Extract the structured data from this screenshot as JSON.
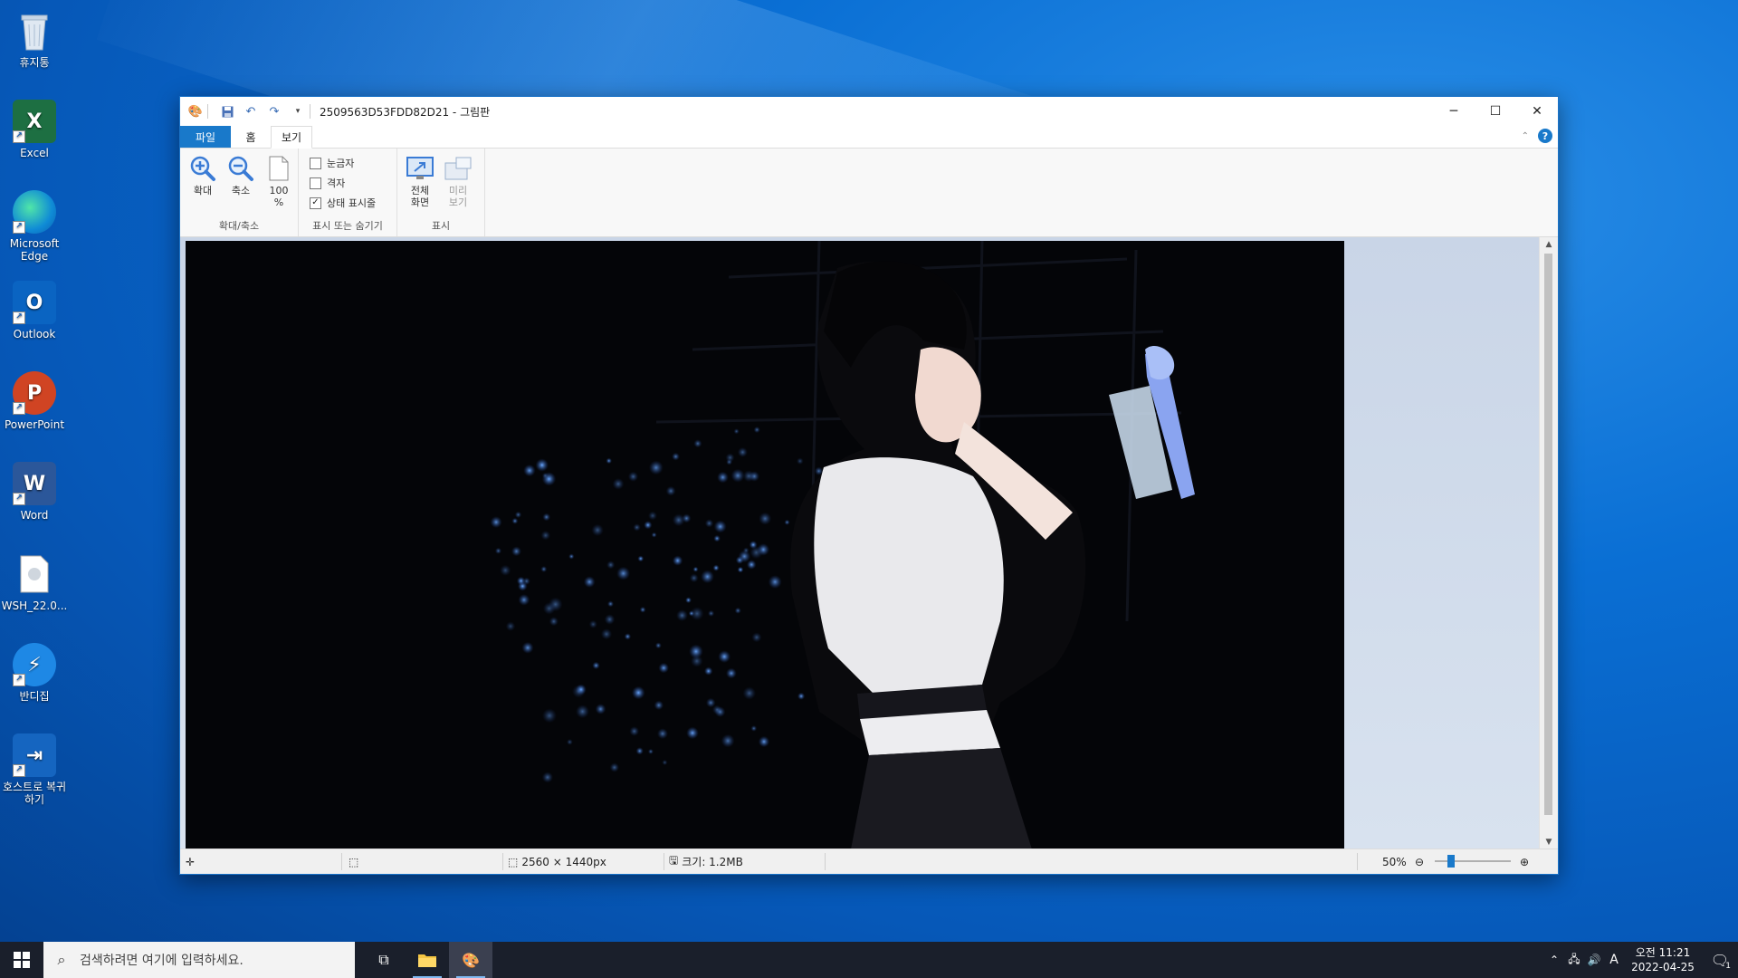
{
  "desktop": {
    "icons": [
      {
        "label": "휴지통",
        "icon": "recycle-bin-icon"
      },
      {
        "label": "Excel",
        "icon": "excel-icon",
        "color": "#1d6f42",
        "glyph": "X"
      },
      {
        "label": "Microsoft Edge",
        "icon": "edge-icon",
        "color": "#0f8bd6"
      },
      {
        "label": "Outlook",
        "icon": "outlook-icon",
        "color": "#0a64c2",
        "glyph": "O"
      },
      {
        "label": "PowerPoint",
        "icon": "powerpoint-icon",
        "color": "#d04423",
        "glyph": "P"
      },
      {
        "label": "Word",
        "icon": "word-icon",
        "color": "#2b579a",
        "glyph": "W"
      },
      {
        "label": "WSH_22.0...",
        "icon": "file-icon"
      },
      {
        "label": "반디집",
        "icon": "bandizip-icon",
        "color": "#1e88e5"
      },
      {
        "label": "호스트로 복귀하기",
        "icon": "return-host-icon",
        "color": "#1565c0"
      }
    ]
  },
  "window": {
    "title": "2509563D53FDD82D21 - 그림판",
    "menu": {
      "file": "파일",
      "home": "홈",
      "view": "보기"
    },
    "ribbon": {
      "zoom_in": "확대",
      "zoom_out": "축소",
      "hundred_line1": "100",
      "hundred_line2": "%",
      "zoom_group": "확대/축소",
      "rulers": "눈금자",
      "gridlines": "격자",
      "statusbar": "상태 표시줄",
      "showhide_group": "표시 또는 숨기기",
      "fullscreen_line1": "전체",
      "fullscreen_line2": "화면",
      "thumbnail_line1": "미리",
      "thumbnail_line2": "보기",
      "display_group": "표시"
    },
    "status": {
      "dimensions": "2560 × 1440px",
      "size": "크기: 1.2MB",
      "zoom": "50%",
      "zoom_level": 0.22
    }
  },
  "taskbar": {
    "search_placeholder": "검색하려면 여기에 입력하세요.",
    "ime": "A",
    "time": "오전 11:21",
    "date": "2022-04-25",
    "notification_count": "1"
  }
}
